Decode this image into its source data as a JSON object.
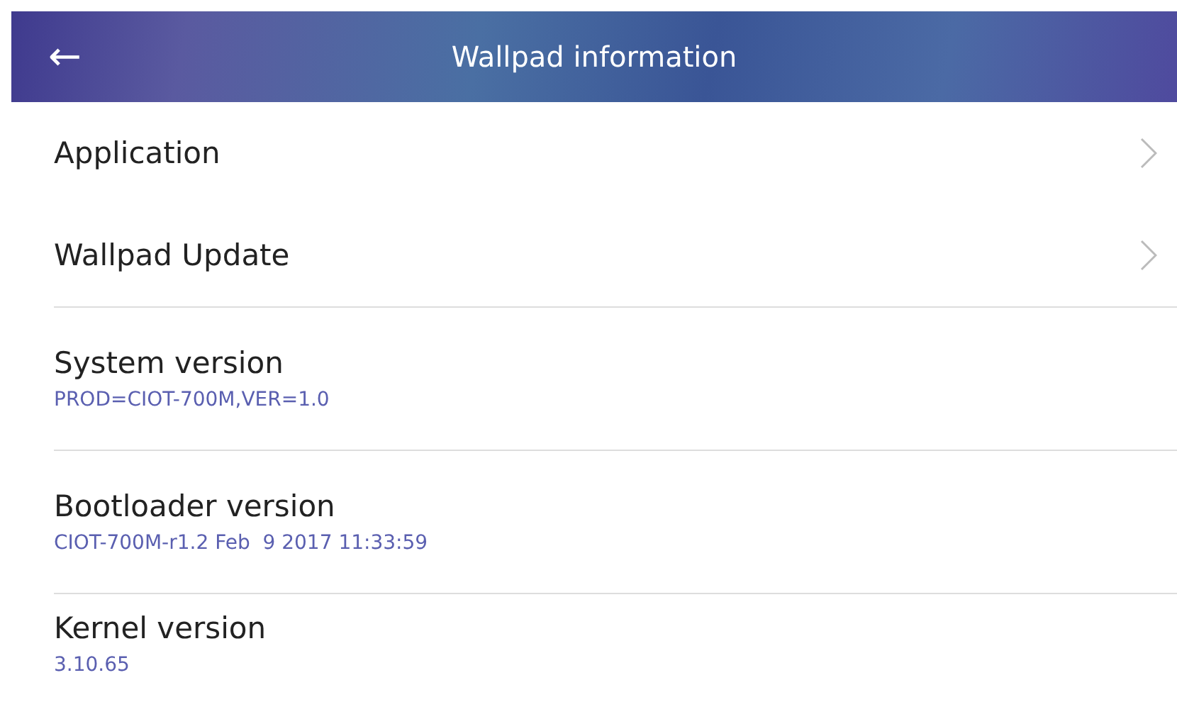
{
  "header": {
    "title": "Wallpad information",
    "back": "←"
  },
  "links": [
    {
      "label": "Application"
    },
    {
      "label": "Wallpad Update"
    }
  ],
  "info": [
    {
      "label": "System version",
      "value": "PROD=CIOT-700M,VER=1.0"
    },
    {
      "label": "Bootloader version",
      "value": "CIOT-700M-r1.2 Feb  9 2017 11:33:59"
    },
    {
      "label": "Kernel version",
      "value": "3.10.65"
    }
  ]
}
